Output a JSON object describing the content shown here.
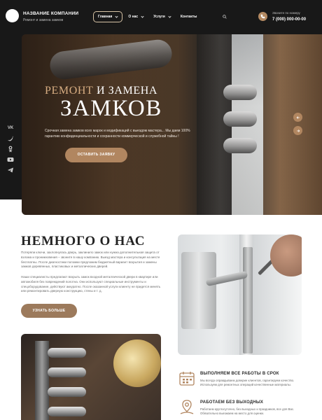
{
  "header": {
    "brand_title": "НАЗВАНИЕ КОМПАНИИ",
    "brand_subtitle": "Ремонт и замена замков",
    "nav": [
      {
        "label": "Главная",
        "active": true,
        "has_dropdown": true
      },
      {
        "label": "О нас",
        "active": false,
        "has_dropdown": true
      },
      {
        "label": "Услуги",
        "active": false,
        "has_dropdown": true
      },
      {
        "label": "Контакты",
        "active": false,
        "has_dropdown": false
      }
    ],
    "phone_label": "Звоните по номеру",
    "phone_number": "7 (000) 000-00-00"
  },
  "social": [
    "VK",
    "twitter-icon",
    "ok-icon",
    "youtube-icon",
    "telegram-icon"
  ],
  "hero": {
    "title_accent": "РЕМОНТ",
    "title_line1_rest": " И ЗАМЕНА",
    "title_line2": "ЗАМКОВ",
    "description": "Срочная замена замков всех марок и модификаций с выездом мастера... Мы даем 100% гарантию конфиденциальности и сохранности коммерческой и служебной тайны !",
    "button_label": "ОСТАВИТЬ ЗАЯВКУ"
  },
  "about": {
    "title": "НЕМНОГО О НАС",
    "paragraph1": "Потеряли ключи, захлопнулась дверь, заклинило замок или нужна дополнительная защита от взлома и проникновения – звоните в нашу компанию. Выезд мастера и консультация на месте бесплатны. После диагностики поломки предложим бюджетный вариант вскрытия и замены замков деревянных, пластиковых и металлических дверей.",
    "paragraph2": "Наши специалисты предлагают вскрыть замок входной металлической двери в квартире или автомобиля без повреждений полотна. Они используют специальные инструменты и спецоборудование, действуют аккуратно. После оказанной услуги клиенту не придется менять или ремонтировать дверную конструкцию, стены и т. д.",
    "button_label": "УЗНАТЬ БОЛЬШЕ"
  },
  "features": [
    {
      "icon": "calendar-icon",
      "title": "ВЫПОЛНЯЕМ ВСЕ РАБОТЫ В СРОК",
      "text": "Мы всегда оправдываем доверие клиентов, гарантируем качество. Используем для ремонтных операций качественные материалы."
    },
    {
      "icon": "location-icon",
      "title": "РАБОТАЕМ БЕЗ ВЫХОДНЫХ",
      "text": "Работаем круглосуточно, без выходных и праздников, все для Вас. Обязательно выезжаем на место для оценки."
    }
  ],
  "colors": {
    "accent": "#b18660",
    "dark": "#181818"
  }
}
